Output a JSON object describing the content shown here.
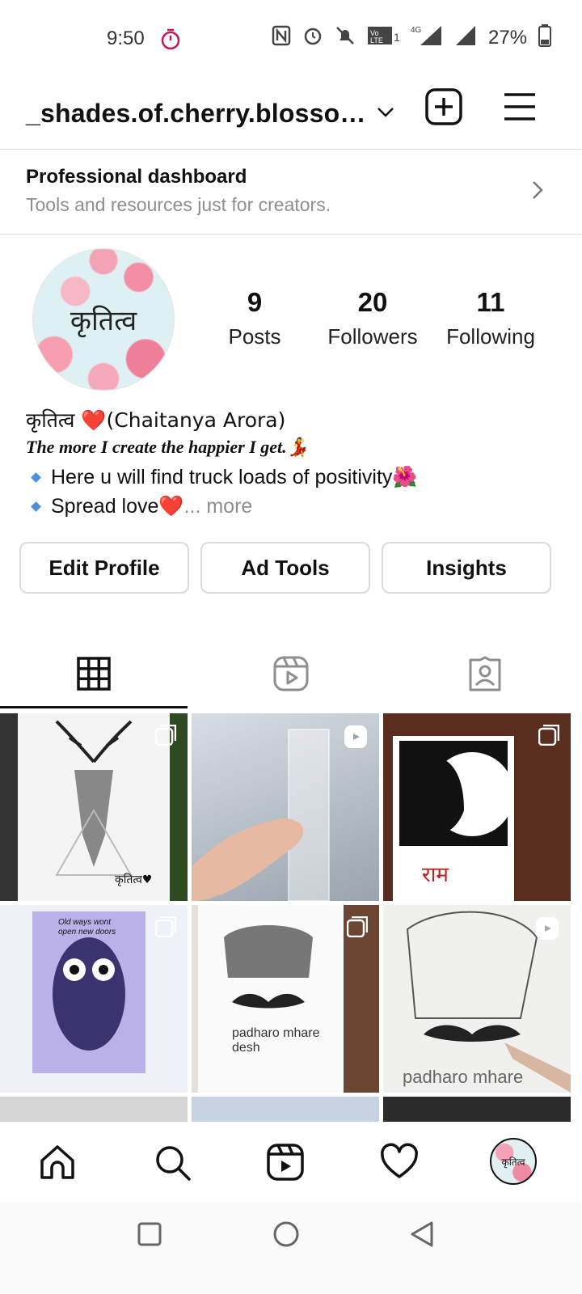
{
  "status_bar": {
    "time": "9:50",
    "battery": "27%",
    "network": "4G"
  },
  "header": {
    "username": "_shades.of.cherry.blosso…"
  },
  "dashboard": {
    "title": "Professional dashboard",
    "subtitle": "Tools and resources just for creators."
  },
  "profile": {
    "avatar_text": "कृतित्व",
    "stats": [
      {
        "num": "9",
        "label": "Posts"
      },
      {
        "num": "20",
        "label": "Followers"
      },
      {
        "num": "11",
        "label": "Following"
      }
    ],
    "bio_name": "कृतित्व ❤️(Chaitanya Arora)",
    "bio_tagline": "The more I create the happier I get.💃",
    "bio_line1": "Here u will find truck loads of positivity🌺",
    "bio_line2": "Spread love❤️",
    "bio_more": "... more"
  },
  "buttons": {
    "edit": "Edit Profile",
    "ad_tools": "Ad Tools",
    "insights": "Insights"
  },
  "grid_posts": [
    {
      "caption": "कृतित्व♥",
      "type": "carousel"
    },
    {
      "caption": "",
      "type": "reel"
    },
    {
      "caption": "राम",
      "type": "carousel"
    },
    {
      "caption": "Old ways wont open new doors",
      "type": "carousel"
    },
    {
      "caption": "padharo mhare desh",
      "type": "carousel"
    },
    {
      "caption": "padharo mhare",
      "type": "reel"
    }
  ],
  "colors": {
    "accent_blue": "#4a90e2",
    "border": "#dbdbdb",
    "muted": "#8e8e8e"
  }
}
